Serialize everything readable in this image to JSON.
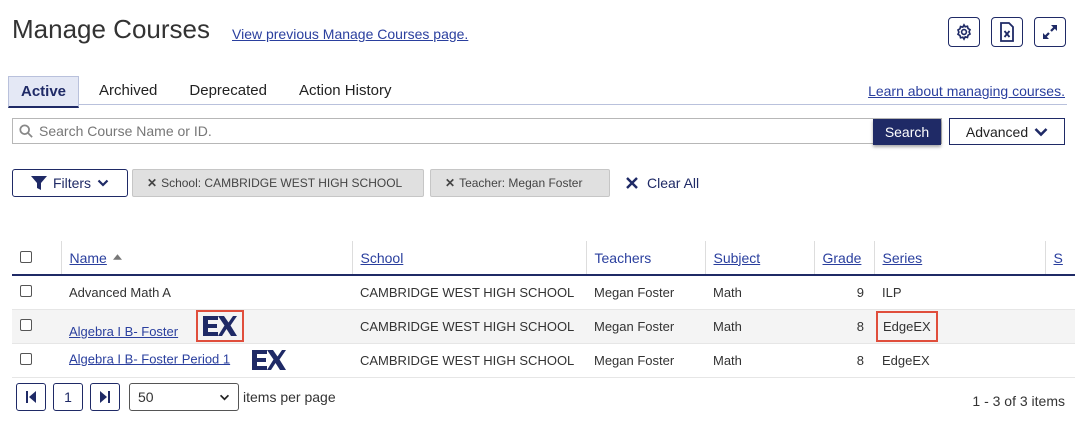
{
  "header": {
    "title": "Manage Courses",
    "prev_link": "View previous Manage Courses page.",
    "icons": [
      "gear-icon",
      "excel-export-icon",
      "expand-icon"
    ]
  },
  "tabs": [
    {
      "label": "Active",
      "active": true
    },
    {
      "label": "Archived",
      "active": false
    },
    {
      "label": "Deprecated",
      "active": false
    },
    {
      "label": "Action History",
      "active": false
    }
  ],
  "learn_link": "Learn about managing courses.",
  "search": {
    "placeholder": "Search Course Name or ID.",
    "value": "",
    "button_label": "Search",
    "advanced_label": "Advanced"
  },
  "filters": {
    "button_label": "Filters",
    "chips": [
      {
        "label": "School: CAMBRIDGE WEST HIGH SCHOOL"
      },
      {
        "label": "Teacher: Megan Foster"
      }
    ],
    "clear_all": "Clear All"
  },
  "table": {
    "columns": [
      "Name",
      "School",
      "Teachers",
      "Subject",
      "Grade",
      "Series",
      "S"
    ],
    "rows": [
      {
        "name": "Advanced Math A",
        "link": false,
        "school": "CAMBRIDGE WEST HIGH SCHOOL",
        "teacher": "Megan Foster",
        "subject": "Math",
        "grade": "9",
        "series": "ILP",
        "ex_logo": false
      },
      {
        "name": "Algebra I B- Foster",
        "link": true,
        "school": "CAMBRIDGE WEST HIGH SCHOOL",
        "teacher": "Megan Foster",
        "subject": "Math",
        "grade": "8",
        "series": "EdgeEX",
        "ex_logo": true
      },
      {
        "name": "Algebra I B- Foster Period 1",
        "link": true,
        "school": "CAMBRIDGE WEST HIGH SCHOOL",
        "teacher": "Megan Foster",
        "subject": "Math",
        "grade": "8",
        "series": "EdgeEX",
        "ex_logo": true
      }
    ]
  },
  "pager": {
    "current_page": "1",
    "page_size": "50",
    "items_per_page_label": "items per page",
    "count_text": "1 - 3 of 3 items"
  },
  "colors": {
    "primary": "#1f2a66",
    "link": "#2a3f9e",
    "highlight": "#e04e3c"
  }
}
